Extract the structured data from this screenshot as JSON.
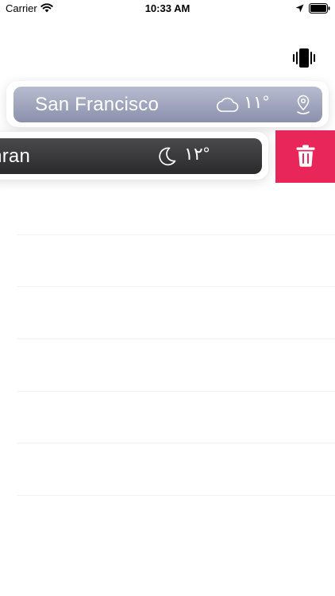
{
  "status_bar": {
    "carrier": "Carrier",
    "time": "10:33 AM"
  },
  "toolbar": {
    "vibrate_icon": "vibrate-icon"
  },
  "cities": [
    {
      "name": "San Francisco",
      "weather_icon": "cloud-icon",
      "temperature": "١١°",
      "action_icon": "location-pin-icon",
      "card_color_top": "#b8bcd0",
      "card_color_bottom": "#8b90ac"
    },
    {
      "name": "nran",
      "weather_icon": "moon-icon",
      "temperature": "١٢°",
      "card_color_top": "#4a4a4c",
      "card_color_bottom": "#2a2a2c",
      "swiped": true
    }
  ],
  "delete_action": {
    "icon": "trash-icon",
    "color": "#e8265a"
  },
  "empty_rows": 6
}
